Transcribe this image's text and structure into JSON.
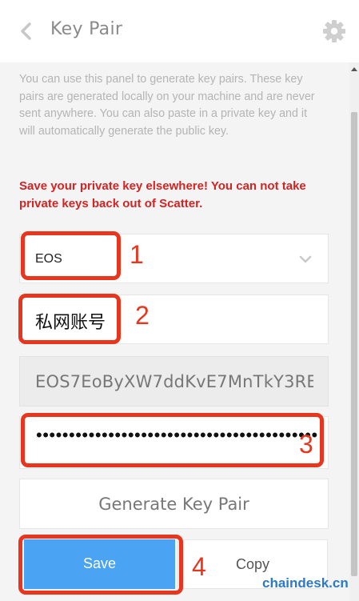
{
  "header": {
    "title": "Key Pair",
    "back_icon": "chevron-left-icon",
    "settings_icon": "gear-icon"
  },
  "description": "You can use this panel to generate key pairs. These key pairs are generated locally on your machine and are never sent anywhere. You can also paste in a private key and it will automatically generate the public key.",
  "warning": "Save your private key elsewhere! You can not take private keys back out of Scatter.",
  "form": {
    "blockchain_select": {
      "value": "EOS",
      "icon": "chevron-down-icon"
    },
    "name_field": {
      "value": "私网账号"
    },
    "public_key_field": {
      "value": "EOS7EoByXW7ddKvE7MnTkY3RE"
    },
    "private_key_field": {
      "value": "••••••••••••••••••••••••••••••••••••••••••••••••••••"
    },
    "generate_label": "Generate Key Pair",
    "save_label": "Save",
    "copy_label": "Copy"
  },
  "annotations": {
    "n1": "1",
    "n2": "2",
    "n3": "3",
    "n4": "4"
  },
  "watermark": "chaindesk.cn",
  "colors": {
    "warning": "#d32323",
    "save_button": "#4aa3f3",
    "annotation": "#e8361e",
    "watermark": "#2c79c8"
  }
}
